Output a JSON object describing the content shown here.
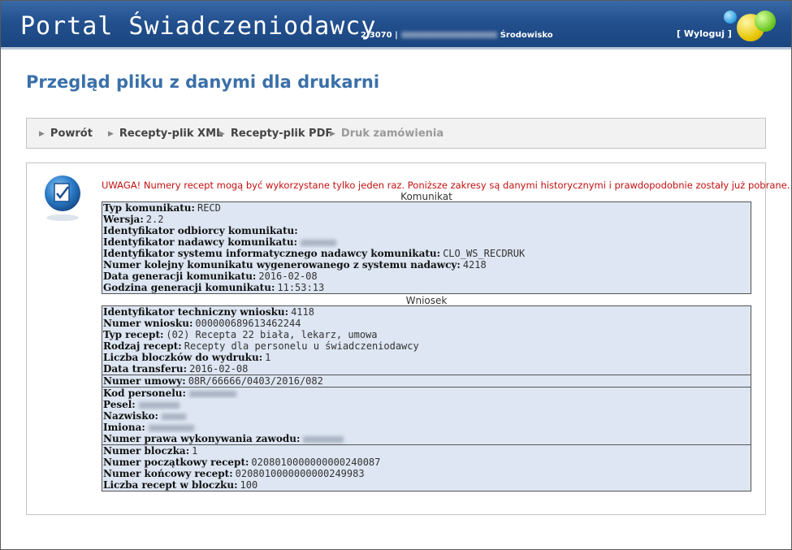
{
  "app": {
    "title": "Portal Świadczeniodawcy",
    "version": "2.3070 |",
    "environment_label": "Środowisko",
    "logout": "[ Wyloguj ]"
  },
  "page": {
    "title": "Przegląd pliku z danymi dla drukarni"
  },
  "nav": {
    "items": [
      {
        "label": "Powrót",
        "enabled": true
      },
      {
        "label": "Recepty-plik XML",
        "enabled": true
      },
      {
        "label": "Recepty-plik PDF",
        "enabled": true
      },
      {
        "label": "Druk zamówienia",
        "enabled": false
      }
    ]
  },
  "warning": "UWAGA! Numery recept mogą być wykorzystane tylko jeden raz. Poniższe zakresy są danymi historycznymi i prawdopodobnie zostały już pobrane.",
  "komunikat": {
    "caption": "Komunikat",
    "rows": [
      {
        "label": "Typ komunikatu:",
        "value": "RECD"
      },
      {
        "label": "Wersja:",
        "value": "2.2"
      },
      {
        "label": "Identyfikator odbiorcy komunikatu:",
        "value": ""
      },
      {
        "label": "Identyfikator nadawcy komunikatu:",
        "value": ""
      },
      {
        "label": "Identyfikator systemu informatycznego nadawcy komunikatu:",
        "value": "CLO_WS_RECDRUK"
      },
      {
        "label": "Numer kolejny komunikatu wygenerowanego z systemu nadawcy:",
        "value": "4218"
      },
      {
        "label": "Data generacji komunikatu:",
        "value": "2016-02-08"
      },
      {
        "label": "Godzina generacji komunikatu:",
        "value": "11:53:13"
      }
    ]
  },
  "wniosek": {
    "caption": "Wniosek",
    "group1": [
      {
        "label": "Identyfikator techniczny wniosku:",
        "value": "4118"
      },
      {
        "label": "Numer wniosku:",
        "value": "000000689613462244"
      },
      {
        "label": "Typ recept:",
        "value": "(02) Recepta 22 biała, lekarz, umowa"
      },
      {
        "label": "Rodzaj recept:",
        "value": "Recepty dla personelu u świadczeniodawcy"
      },
      {
        "label": "Liczba bloczków do wydruku:",
        "value": "1"
      },
      {
        "label": "Data transferu:",
        "value": "2016-02-08"
      }
    ],
    "group2": [
      {
        "label": "Numer umowy:",
        "value": "08R/66666/0403/2016/082"
      }
    ],
    "group3": [
      {
        "label": "Kod personelu:",
        "value": ""
      },
      {
        "label": "Pesel:",
        "value": ""
      },
      {
        "label": "Nazwisko:",
        "value": ""
      },
      {
        "label": "Imiona:",
        "value": ""
      },
      {
        "label": "Numer prawa wykonywania zawodu:",
        "value": ""
      }
    ],
    "group4": [
      {
        "label": "Numer bloczka:",
        "value": "1"
      },
      {
        "label": "Numer początkowy recept:",
        "value": "0208010000000000240087"
      },
      {
        "label": "Numer końcowy recept:",
        "value": "0208010000000000249983"
      },
      {
        "label": "Liczba recept w bloczku:",
        "value": "100"
      }
    ]
  }
}
